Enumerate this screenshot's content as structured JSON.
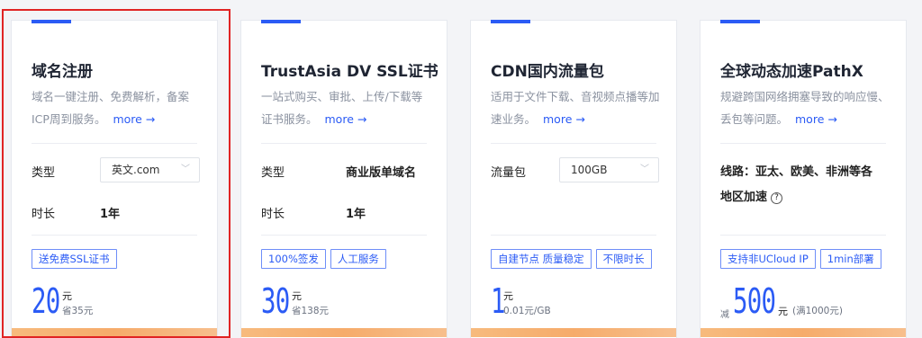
{
  "colors": {
    "accent": "#2b5bf5",
    "highlight": "#e02424",
    "price_bar": "#f5a25a"
  },
  "cards": [
    {
      "title": "域名注册",
      "desc": "域名一键注册、免费解析，备案ICP周到服务。",
      "more": "more →",
      "rows": [
        {
          "label": "类型",
          "value": "英文.com",
          "control": "select"
        },
        {
          "label": "时长",
          "value": "1年"
        }
      ],
      "tags": [
        "送免费SSL证书"
      ],
      "price": {
        "amount": "20",
        "unit": "元",
        "sub": "省35元"
      }
    },
    {
      "title": "TrustAsia DV SSL证书",
      "desc": "一站式购买、审批、上传/下载等证书服务。",
      "more": "more →",
      "rows": [
        {
          "label": "类型",
          "value": "商业版单域名"
        },
        {
          "label": "时长",
          "value": "1年"
        }
      ],
      "tags": [
        "100%签发",
        "人工服务"
      ],
      "price": {
        "amount": "30",
        "unit": "元",
        "sub": "省138元"
      }
    },
    {
      "title": "CDN国内流量包",
      "desc": "适用于文件下载、音视频点播等加速业务。",
      "more": "more →",
      "rows": [
        {
          "label": "流量包",
          "value": "100GB",
          "control": "select"
        }
      ],
      "tags": [
        "自建节点 质量稳定",
        "不限时长"
      ],
      "price": {
        "amount": "1",
        "unit": "元",
        "sub": "0.01元/GB"
      }
    },
    {
      "title": "全球动态加速PathX",
      "desc": "规避跨国网络拥塞导致的响应慢、丢包等问题。",
      "more": "more →",
      "line_info": "线路：亚太、欧美、非洲等各地区加速",
      "help_icon": "question-circle-icon",
      "tags": [
        "支持非UCloud IP",
        "1min部署"
      ],
      "price": {
        "prefix": "减",
        "amount": "500",
        "unit": "元",
        "sub": "(满1000元)"
      }
    }
  ]
}
